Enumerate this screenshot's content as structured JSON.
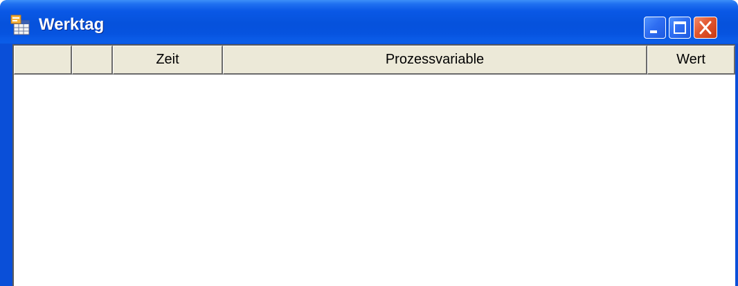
{
  "window": {
    "title": "Werktag",
    "icon": "table-app-icon",
    "controls": {
      "minimize_icon": "minimize-icon",
      "maximize_icon": "maximize-icon",
      "close_icon": "close-icon"
    }
  },
  "table": {
    "columns": [
      {
        "key": "col1",
        "label": ""
      },
      {
        "key": "col2",
        "label": ""
      },
      {
        "key": "zeit",
        "label": "Zeit"
      },
      {
        "key": "prozessvariable",
        "label": "Prozessvariable"
      },
      {
        "key": "wert",
        "label": "Wert"
      }
    ],
    "rows": []
  },
  "colors": {
    "titlebar": "#0652dc",
    "header_bg": "#ece9d8",
    "close_button": "#e2562e"
  }
}
